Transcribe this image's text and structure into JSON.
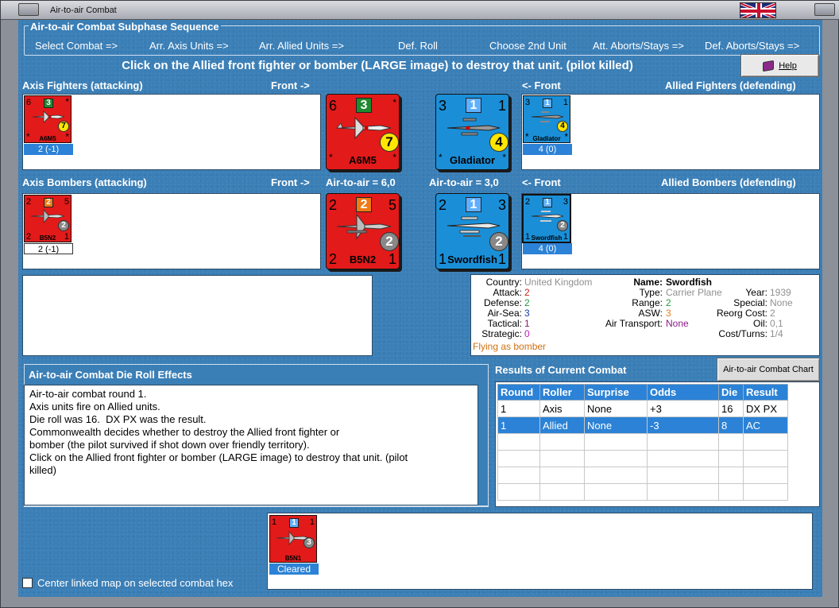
{
  "window": {
    "title": "Air-to-air Combat"
  },
  "sequence": {
    "title": "Air-to-air Combat Subphase Sequence",
    "steps": [
      "Select Combat =>",
      "Arr. Axis Units =>",
      "Arr. Allied Units =>",
      "Def. Roll",
      "Choose 2nd Unit",
      "Att. Aborts/Stays =>",
      "Def. Aborts/Stays =>"
    ]
  },
  "instruction": "Click on the Allied front fighter or bomber (LARGE image) to destroy that unit. (pilot killed)",
  "help": {
    "label": "Help"
  },
  "sections": {
    "axis_fighters": "Axis Fighters (attacking)",
    "front_right": "Front ->",
    "front_left": "<- Front",
    "allied_fighters": "Allied Fighters (defending)",
    "axis_bombers": "Axis Bombers (attacking)",
    "allied_bombers": "Allied Bombers (defending)",
    "axis_air_to_air": "Air-to-air = 6,0",
    "allied_air_to_air": "Air-to-air = 3,0"
  },
  "units": {
    "a6m5": {
      "name": "A6M5",
      "tl": "6",
      "sq": "3",
      "circ": "7",
      "status": "2 (-1)"
    },
    "b5n2": {
      "name": "B5N2",
      "tl": "2",
      "sq": "2",
      "tr": "5",
      "circ": "2",
      "bl": "2",
      "br": "1",
      "status": "2 (-1)"
    },
    "gladiator": {
      "name": "Gladiator",
      "tl": "3",
      "sq": "1",
      "tr": "1",
      "circ": "4",
      "status": "4 (0)"
    },
    "swordfish": {
      "name": "Swordfish",
      "tl": "2",
      "sq": "1",
      "tr": "3",
      "circ": "2",
      "bl": "1",
      "br": "1",
      "status": "4 (0)"
    },
    "b5n1": {
      "name": "B5N1",
      "tl": "1",
      "sq": "1",
      "tr": "1",
      "circ": "3",
      "status": "Cleared"
    }
  },
  "info": {
    "country_label": "Country:",
    "country": "United Kingdom",
    "attack_label": "Attack:",
    "attack": "2",
    "defense_label": "Defense:",
    "defense": "2",
    "airsea_label": "Air-Sea:",
    "airsea": "3",
    "tactical_label": "Tactical:",
    "tactical": "1",
    "strategic_label": "Strategic:",
    "strategic": "0",
    "flying": "Flying as bomber",
    "name_label": "Name:",
    "name": "Swordfish",
    "type_label": "Type:",
    "type": "Carrier Plane",
    "range_label": "Range:",
    "range": "2",
    "asw_label": "ASW:",
    "asw": "3",
    "air_transport_label": "Air Transport:",
    "air_transport": "None",
    "year_label": "Year:",
    "year": "1939",
    "special_label": "Special:",
    "special": "None",
    "reorg_label": "Reorg Cost:",
    "reorg": "2",
    "oil_label": "Oil:",
    "oil": "0,1",
    "cost_label": "Cost/Turns:",
    "cost": "1/4",
    "colors": {
      "attack": "#cc2222",
      "defense": "#229944",
      "airsea": "#1a3ca8",
      "tactical": "#8a1a6e",
      "strategic": "#c020c0",
      "flying": "#d07010",
      "grey": "#909090",
      "none_purple": "#8a1a8a",
      "asw_orange": "#e08020"
    }
  },
  "die_roll": {
    "title": "Air-to-air Combat Die Roll Effects",
    "lines": [
      "Air-to-air combat round 1.",
      "Axis units fire on Allied units.",
      "Die roll was 16.  DX PX was the result.",
      "Commonwealth decides whether to destroy the Allied front fighter or\nbomber (the pilot survived if shot down over friendly territory).",
      "Click on the Allied front fighter or bomber (LARGE image) to destroy that unit. (pilot\nkilled)"
    ]
  },
  "results": {
    "title": "Results of Current Combat",
    "chart_button": "Air-to-air Combat Chart",
    "columns": [
      "Round",
      "Roller",
      "Surprise",
      "Odds",
      "Die",
      "Result"
    ],
    "rows": [
      [
        "1",
        "Axis",
        "None",
        "+3",
        "16",
        "DX PX"
      ],
      [
        "1",
        "Allied",
        "None",
        "-3",
        "8",
        "AC"
      ]
    ]
  },
  "center_map": {
    "label": "Center linked map on selected combat hex",
    "checked": false
  },
  "colors": {
    "panel_blue": "#3b7fb7",
    "axis_red": "#e21a1a",
    "allied_blue": "#1a8fd8",
    "select_blue": "#2b82d6"
  }
}
